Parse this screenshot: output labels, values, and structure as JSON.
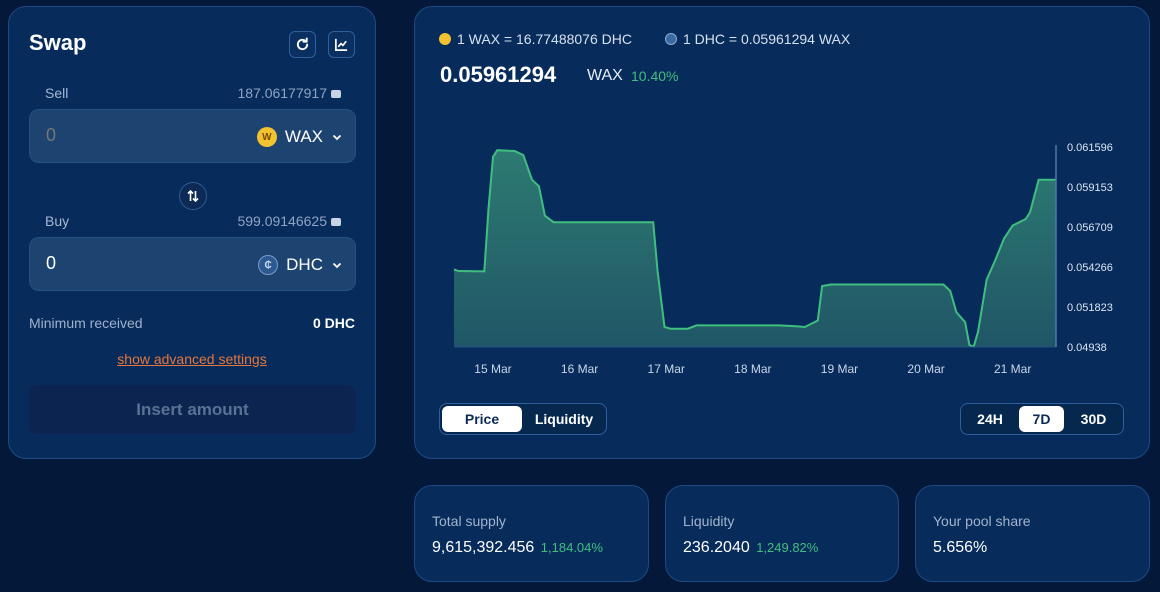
{
  "swap": {
    "title": "Swap",
    "sell": {
      "label": "Sell",
      "balance": "187.06177917",
      "amount": "0",
      "token": "WAX"
    },
    "buy": {
      "label": "Buy",
      "balance": "599.09146625",
      "amount": "0",
      "token": "DHC"
    },
    "minimum_received": {
      "label": "Minimum received",
      "value": "0 DHC"
    },
    "advanced_link": "show advanced settings",
    "submit_label": "Insert amount"
  },
  "rates": {
    "wax_to_dhc": "1 WAX = 16.77488076 DHC",
    "dhc_to_wax": "1 DHC = 0.05961294 WAX"
  },
  "price": {
    "value": "0.05961294",
    "unit": "WAX",
    "change": "10.40%"
  },
  "chart_data": {
    "type": "area",
    "color": "#3fbf7f",
    "x_labels": [
      "15 Mar",
      "16 Mar",
      "17 Mar",
      "18 Mar",
      "19 Mar",
      "20 Mar",
      "21 Mar"
    ],
    "y_ticks": [
      "0.061596",
      "0.059153",
      "0.056709",
      "0.054266",
      "0.051823",
      "0.04938"
    ],
    "ylim": [
      0.04938,
      0.061596
    ],
    "x_domain": [
      14.55,
      21.5
    ],
    "points": [
      [
        14.55,
        0.05412
      ],
      [
        14.6,
        0.05402
      ],
      [
        14.9,
        0.054
      ],
      [
        14.95,
        0.0579
      ],
      [
        15.0,
        0.061
      ],
      [
        15.05,
        0.0614
      ],
      [
        15.25,
        0.06135
      ],
      [
        15.35,
        0.0611
      ],
      [
        15.45,
        0.0596
      ],
      [
        15.53,
        0.0592
      ],
      [
        15.6,
        0.0574
      ],
      [
        15.7,
        0.057
      ],
      [
        16.0,
        0.057
      ],
      [
        16.5,
        0.057
      ],
      [
        16.85,
        0.057
      ],
      [
        16.9,
        0.054
      ],
      [
        16.98,
        0.0506
      ],
      [
        17.05,
        0.0505
      ],
      [
        17.25,
        0.0505
      ],
      [
        17.35,
        0.0507
      ],
      [
        18.0,
        0.0507
      ],
      [
        18.3,
        0.0507
      ],
      [
        18.5,
        0.05065
      ],
      [
        18.6,
        0.0506
      ],
      [
        18.75,
        0.051
      ],
      [
        18.8,
        0.0531
      ],
      [
        18.9,
        0.0532
      ],
      [
        19.5,
        0.0532
      ],
      [
        20.2,
        0.0532
      ],
      [
        20.28,
        0.0528
      ],
      [
        20.35,
        0.0515
      ],
      [
        20.4,
        0.0512
      ],
      [
        20.45,
        0.0509
      ],
      [
        20.5,
        0.0495
      ],
      [
        20.55,
        0.0494
      ],
      [
        20.6,
        0.0503
      ],
      [
        20.7,
        0.0535
      ],
      [
        20.8,
        0.0547
      ],
      [
        20.9,
        0.056
      ],
      [
        21.0,
        0.0568
      ],
      [
        21.15,
        0.0572
      ],
      [
        21.2,
        0.0576
      ],
      [
        21.3,
        0.0596
      ],
      [
        21.4,
        0.0596
      ],
      [
        21.5,
        0.0596
      ]
    ]
  },
  "chart_tabs": [
    "Price",
    "Liquidity"
  ],
  "chart_tab_active": "Price",
  "ranges": [
    "24H",
    "7D",
    "30D"
  ],
  "range_active": "7D",
  "stats": {
    "total_supply": {
      "label": "Total supply",
      "value": "9,615,392.456",
      "change": "1,184.04%"
    },
    "liquidity": {
      "label": "Liquidity",
      "value": "236.2040",
      "change": "1,249.82%"
    },
    "pool_share": {
      "label": "Your pool share",
      "value": "5.656%"
    }
  }
}
